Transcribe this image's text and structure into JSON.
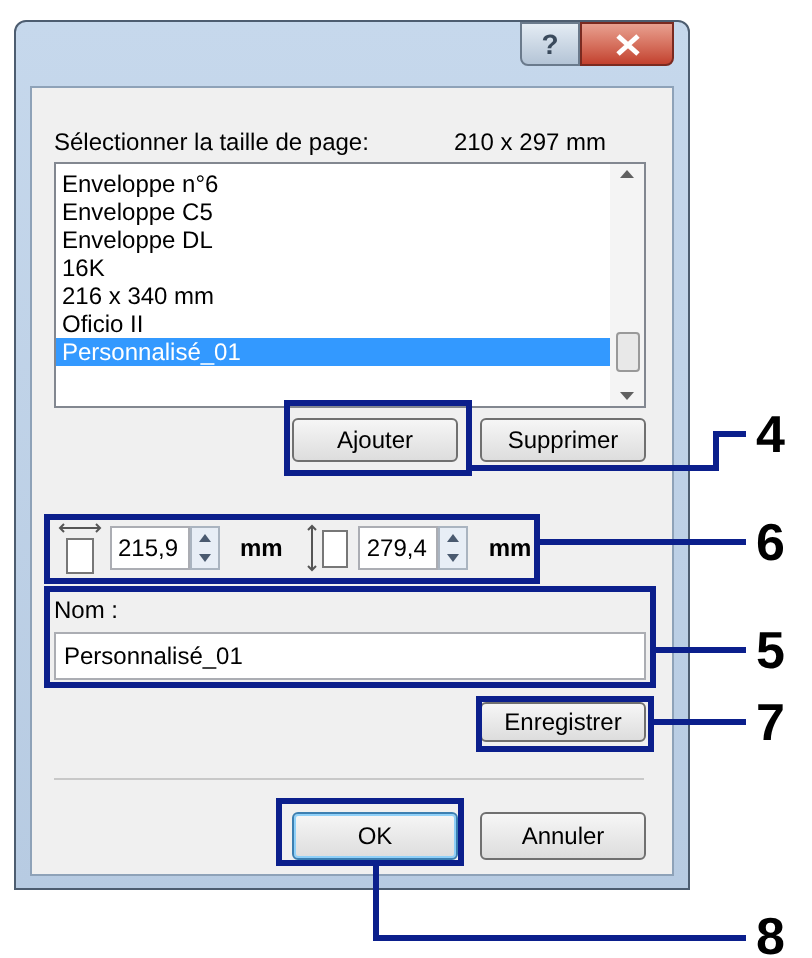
{
  "dialog": {
    "help_button": "?",
    "size_label": "Sélectionner la taille de page:",
    "size_value": "210 x 297 mm",
    "page_sizes": [
      {
        "label": "Enveloppe n°6",
        "selected": false
      },
      {
        "label": "Enveloppe C5",
        "selected": false
      },
      {
        "label": "Enveloppe DL",
        "selected": false
      },
      {
        "label": "16K",
        "selected": false
      },
      {
        "label": "216 x 340 mm",
        "selected": false
      },
      {
        "label": "Oficio II",
        "selected": false
      },
      {
        "label": "Personnalisé_01",
        "selected": true
      }
    ],
    "add_button": "Ajouter",
    "delete_button": "Supprimer",
    "width": {
      "value": "215,9",
      "unit": "mm"
    },
    "height": {
      "value": "279,4",
      "unit": "mm"
    },
    "name_label": "Nom :",
    "name_value": "Personnalisé_01",
    "save_button": "Enregistrer",
    "ok_button": "OK",
    "cancel_button": "Annuler"
  },
  "callouts": [
    {
      "number": "4"
    },
    {
      "number": "6"
    },
    {
      "number": "5"
    },
    {
      "number": "7"
    },
    {
      "number": "8"
    }
  ]
}
